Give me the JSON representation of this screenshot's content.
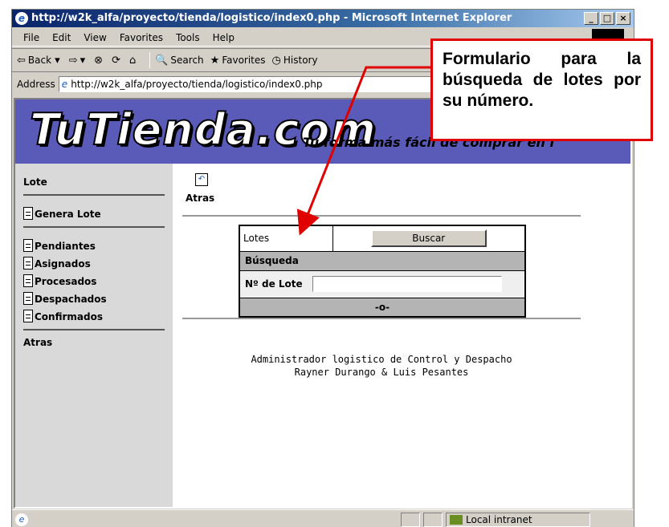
{
  "window": {
    "title": "http://w2k_alfa/proyecto/tienda/logistico/index0.php - Microsoft Internet Explorer",
    "buttons": [
      "_",
      "□",
      "×"
    ]
  },
  "menu": [
    "File",
    "Edit",
    "View",
    "Favorites",
    "Tools",
    "Help"
  ],
  "toolbar": {
    "back": "Back",
    "search": "Search",
    "favorites": "Favorites",
    "history": "History"
  },
  "address": {
    "label": "Address",
    "url": "http://w2k_alfa/proyecto/tienda/logistico/index0.php"
  },
  "banner": {
    "logo": "TuTienda.com",
    "tagline": "Tu forma más fácil de comprar en i"
  },
  "sidebar": {
    "title": "Lote",
    "generate": "Genera Lote",
    "items": [
      "Pendiantes",
      "Asignados",
      "Procesados",
      "Despachados",
      "Confirmados"
    ],
    "back": "Atras"
  },
  "main": {
    "back_label": "Atras",
    "form": {
      "title": "Lotes",
      "button": "Buscar",
      "section": "Búsqueda",
      "field_label": "Nº de Lote",
      "field_value": "",
      "footer": "-o-"
    },
    "footer_line1": "Administrador logistico de Control y Despacho",
    "footer_line2": "Rayner Durango & Luis Pesantes"
  },
  "status": {
    "zone": "Local intranet"
  },
  "callout": {
    "text": "Formulario para la búsqueda de lotes por su número.",
    "color": "#e00000"
  }
}
